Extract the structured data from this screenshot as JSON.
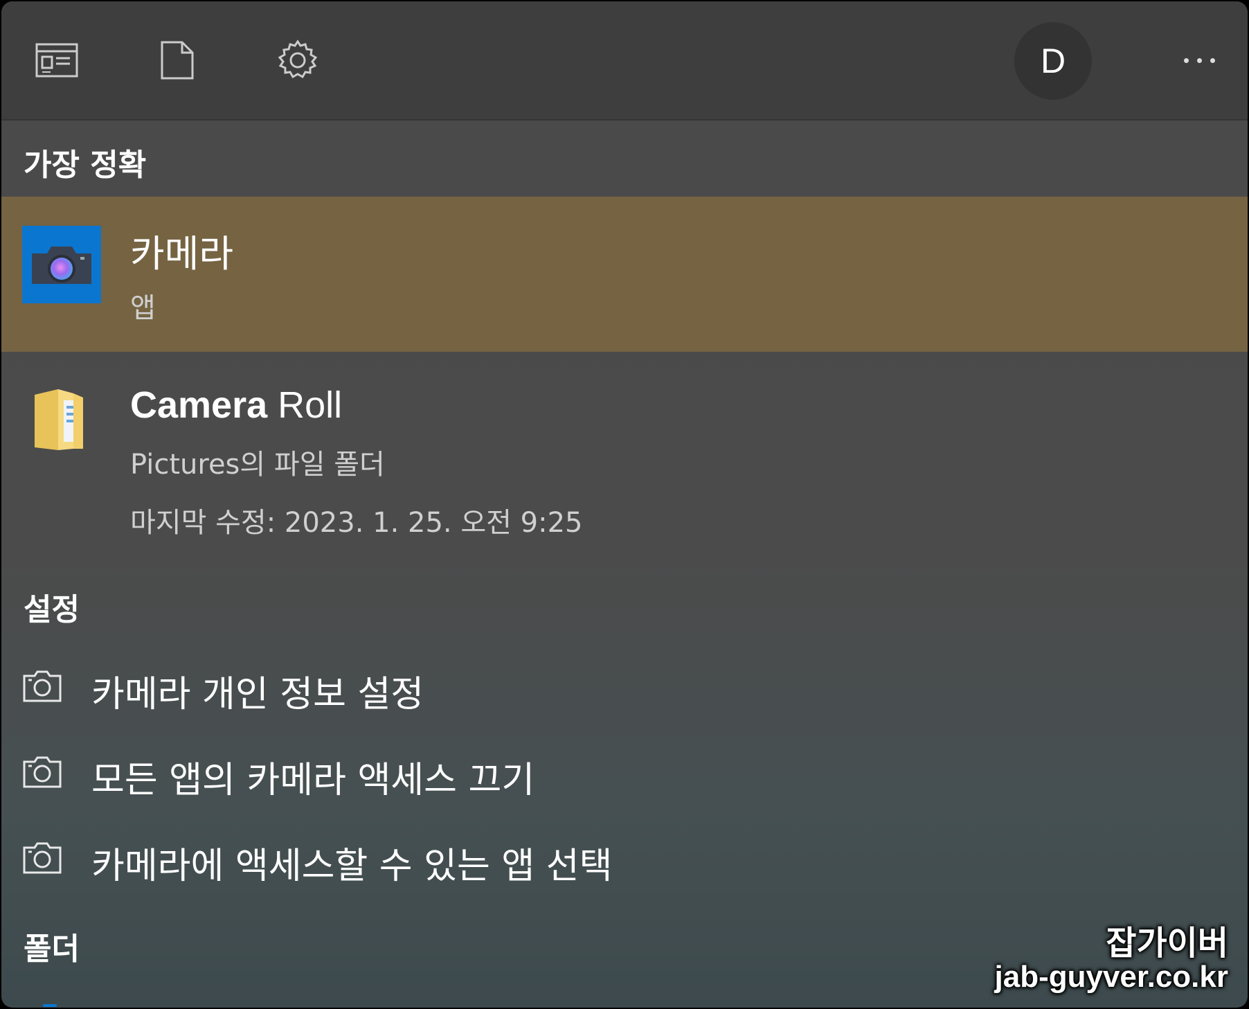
{
  "topbar": {
    "icons": [
      "news-icon",
      "document-icon",
      "gear-icon"
    ],
    "avatar_letter": "D",
    "more_icon": "ellipsis-icon"
  },
  "sections": {
    "best_match": "가장 정확",
    "settings": "설정",
    "folders": "폴더"
  },
  "best_match": {
    "title": "카메라",
    "subtitle": "앱",
    "icon": "camera-app-icon",
    "highlight_color": "#756342"
  },
  "camera_roll": {
    "title_bold": "Camera",
    "title_rest": "Roll",
    "subtitle": "Pictures의 파일 폴더",
    "modified": "마지막 수정: 2023. 1. 25. 오전 9:25",
    "icon": "folder-icon"
  },
  "settings_items": [
    {
      "label": "카메라 개인 정보 설정",
      "icon": "camera-outline-icon"
    },
    {
      "label": "모든 앱의 카메라 액세스 끄기",
      "icon": "camera-outline-icon"
    },
    {
      "label": "카메라에 액세스할 수 있는 앱 선택",
      "icon": "camera-outline-icon"
    }
  ],
  "watermark": {
    "line1": "잡가이버",
    "line2": "jab-guyver.co.kr"
  }
}
